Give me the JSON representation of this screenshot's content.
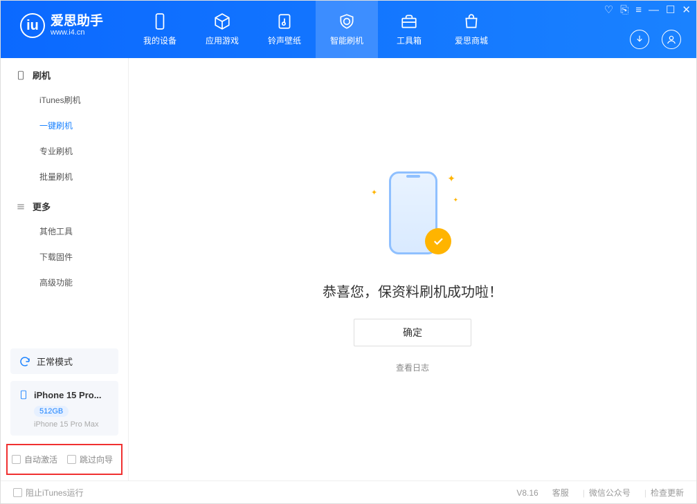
{
  "brand": {
    "name": "爱思助手",
    "url": "www.i4.cn",
    "logo_letter": "iu"
  },
  "nav": [
    {
      "key": "device",
      "label": "我的设备"
    },
    {
      "key": "apps",
      "label": "应用游戏"
    },
    {
      "key": "ringtone",
      "label": "铃声壁纸"
    },
    {
      "key": "flash",
      "label": "智能刷机",
      "active": true
    },
    {
      "key": "toolbox",
      "label": "工具箱"
    },
    {
      "key": "store",
      "label": "爱思商城"
    }
  ],
  "sidebar": {
    "groups": [
      {
        "title": "刷机",
        "icon": "phone",
        "items": [
          {
            "label": "iTunes刷机"
          },
          {
            "label": "一键刷机",
            "active": true
          },
          {
            "label": "专业刷机"
          },
          {
            "label": "批量刷机"
          }
        ]
      },
      {
        "title": "更多",
        "icon": "more",
        "items": [
          {
            "label": "其他工具"
          },
          {
            "label": "下载固件"
          },
          {
            "label": "高级功能"
          }
        ]
      }
    ],
    "mode_label": "正常模式",
    "device": {
      "name": "iPhone 15 Pro...",
      "storage": "512GB",
      "model": "iPhone 15 Pro Max"
    },
    "checks": {
      "auto_activate": "自动激活",
      "skip_guide": "跳过向导"
    }
  },
  "main": {
    "success_text": "恭喜您，保资料刷机成功啦！",
    "ok_btn": "确定",
    "view_log": "查看日志"
  },
  "footer": {
    "block_itunes": "阻止iTunes运行",
    "version": "V8.16",
    "links": [
      "客服",
      "微信公众号",
      "检查更新"
    ]
  }
}
